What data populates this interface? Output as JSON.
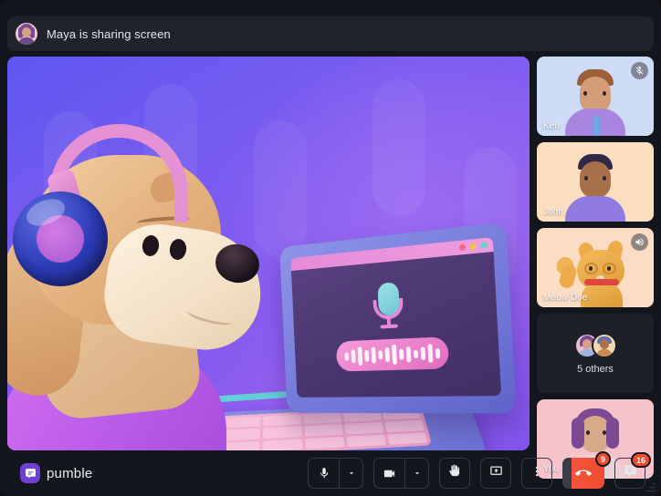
{
  "header": {
    "status_text": "Maya is sharing screen",
    "avatar_name": "Maya"
  },
  "stage": {
    "shared_content_description": "3D illustration of a dog wearing pink and blue headphones beside an open laptop showing a microphone and audio waveform"
  },
  "sidebar": {
    "tiles": [
      {
        "label": "Ken",
        "bg": "#cfdcf7",
        "icon": "mic-muted-icon",
        "has_icon": true
      },
      {
        "label": "John",
        "bg": "#fbddc0",
        "icon": "",
        "has_icon": false
      },
      {
        "label": "Meow Doe",
        "bg": "#fbdcc4",
        "icon": "speaker-on-icon",
        "has_icon": true
      },
      {
        "label": "You",
        "bg": "#f7c3cb",
        "icon": "",
        "has_icon": false
      }
    ],
    "others": {
      "label": "5 others",
      "count": 5
    }
  },
  "footer": {
    "brand_name": "pumble",
    "controls": [
      {
        "name": "microphone",
        "icon": "microphone-icon",
        "has_chevron": true,
        "badge": ""
      },
      {
        "name": "camera",
        "icon": "video-camera-icon",
        "has_chevron": true,
        "badge": ""
      },
      {
        "name": "raise-hand",
        "icon": "raised-hand-icon",
        "has_chevron": false,
        "badge": ""
      },
      {
        "name": "screen-share",
        "icon": "screen-share-icon",
        "has_chevron": false,
        "badge": ""
      },
      {
        "name": "more-options",
        "icon": "more-vertical-icon",
        "has_chevron": false,
        "badge": ""
      },
      {
        "name": "leave-call",
        "icon": "leave-call-icon",
        "has_chevron": false,
        "badge": "9"
      },
      {
        "name": "chat",
        "icon": "chat-icon",
        "has_chevron": false,
        "badge": "16"
      }
    ]
  },
  "colors": {
    "app_bg": "#14161d",
    "panel_bg": "#20232c",
    "tile_dark": "#1d2029",
    "accent_purple": "#6e3fd4",
    "danger_red": "#f04a2e",
    "text_primary": "#e4e6ea"
  }
}
